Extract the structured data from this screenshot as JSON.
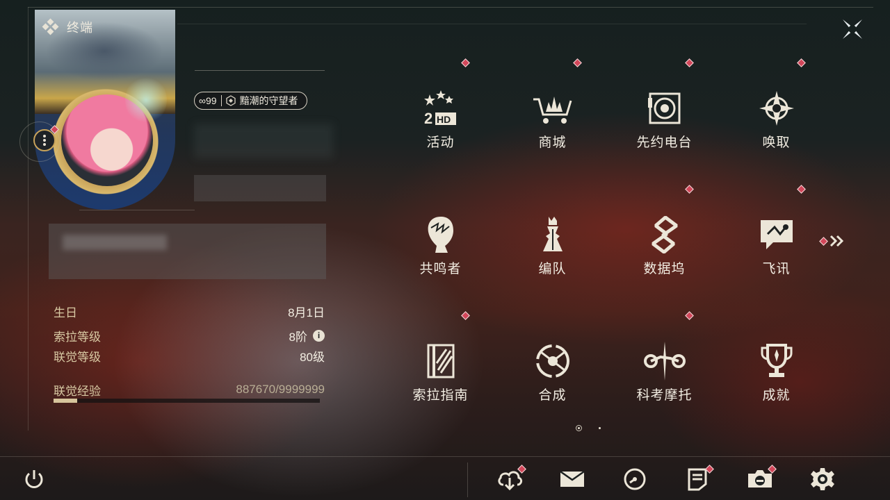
{
  "window": {
    "title": "终端"
  },
  "profile": {
    "level_badge": "∞99",
    "title_badge": "黯潮的守望者"
  },
  "stats": [
    {
      "label": "生日",
      "value": "8月1日",
      "info": false
    },
    {
      "label": "索拉等级",
      "value": "8阶",
      "info": true
    },
    {
      "label": "联觉等级",
      "value": "80级",
      "info": false
    }
  ],
  "exp": {
    "label": "联觉经验",
    "value": "887670/9999999",
    "fraction": 0.0888
  },
  "info_icon_glyph": "i",
  "menu": [
    {
      "label": "活动",
      "icon": "event-2hd-icon",
      "badge": true
    },
    {
      "label": "商城",
      "icon": "shop-cart-icon",
      "badge": true
    },
    {
      "label": "先约电台",
      "icon": "radio-disc-icon",
      "badge": true
    },
    {
      "label": "唤取",
      "icon": "convene-star-icon",
      "badge": true
    },
    {
      "label": "共鸣者",
      "icon": "resonator-head-icon",
      "badge": false
    },
    {
      "label": "编队",
      "icon": "team-chess-icon",
      "badge": false
    },
    {
      "label": "数据坞",
      "icon": "data-dock-icon",
      "badge": true
    },
    {
      "label": "飞讯",
      "icon": "message-chat-icon",
      "badge": true
    },
    {
      "label": "索拉指南",
      "icon": "guidebook-icon",
      "badge": true
    },
    {
      "label": "合成",
      "icon": "synthesis-icon",
      "badge": false
    },
    {
      "label": "科考摩托",
      "icon": "motorcycle-icon",
      "badge": true
    },
    {
      "label": "成就",
      "icon": "trophy-icon",
      "badge": false
    }
  ],
  "bottom_bar": [
    {
      "icon": "cloud-download-icon",
      "badge": true
    },
    {
      "icon": "mail-icon",
      "badge": false
    },
    {
      "icon": "clock-icon",
      "badge": false
    },
    {
      "icon": "notice-icon",
      "badge": true
    },
    {
      "icon": "camera-icon",
      "badge": true
    },
    {
      "icon": "settings-gear-icon",
      "badge": false
    }
  ],
  "pagination": {
    "pages": 2,
    "current": 1
  },
  "colors": {
    "accent_gold": "#c8a35a",
    "badge_red": "#d2475a",
    "label_gold": "#d8c9a3"
  }
}
